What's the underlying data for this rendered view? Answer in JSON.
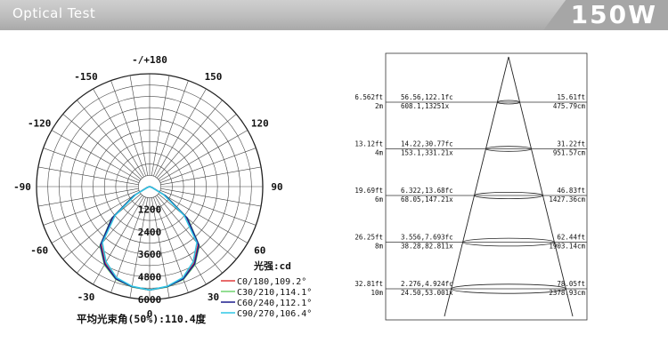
{
  "header": {
    "title": "Optical Test",
    "power": "150W"
  },
  "chart_data": [
    {
      "type": "polar-intensity",
      "angle_labels": [
        "-/+180",
        "-150",
        "150",
        "-120",
        "120",
        "-90",
        "90",
        "-60",
        "60",
        "-30",
        "30",
        "0"
      ],
      "radial_ticks": [
        1200,
        2400,
        3600,
        4800,
        6000
      ],
      "unit_label": "光强:cd",
      "series": [
        {
          "name": "C0/180,109.2°",
          "color": "#e03a3a",
          "values": [
            5500,
            5400,
            5200,
            4700,
            4000,
            2500,
            900,
            120,
            0
          ]
        },
        {
          "name": "C30/210,114.1°",
          "color": "#6fd36f",
          "values": [
            5500,
            5420,
            5250,
            4800,
            4100,
            2650,
            1000,
            150,
            0
          ]
        },
        {
          "name": "C60/240,112.1°",
          "color": "#1c1c8c",
          "values": [
            5500,
            5400,
            5220,
            4760,
            4060,
            2600,
            960,
            140,
            0
          ]
        },
        {
          "name": "C90/270,106.4°",
          "color": "#2ec7e6",
          "values": [
            5500,
            5380,
            5150,
            4620,
            3900,
            2400,
            850,
            110,
            0
          ]
        }
      ],
      "series_angles": [
        0,
        10,
        20,
        30,
        40,
        50,
        60,
        70,
        80
      ],
      "average_beam_angle": "平均光束角(50%):110.4度"
    },
    {
      "type": "illuminance-cone",
      "rows": [
        {
          "h_ft": "6.562ft",
          "h_m": "2m",
          "fc": "56.56,122.1fc",
          "lx": "608.1,13251x",
          "d_ft": "15.61ft",
          "d_cm": "475.79cm"
        },
        {
          "h_ft": "13.12ft",
          "h_m": "4m",
          "fc": "14.22,30.77fc",
          "lx": "153.1,331.21x",
          "d_ft": "31.22ft",
          "d_cm": "951.57cm"
        },
        {
          "h_ft": "19.69ft",
          "h_m": "6m",
          "fc": "6.322,13.68fc",
          "lx": "68.05,147.21x",
          "d_ft": "46.83ft",
          "d_cm": "1427.36cm"
        },
        {
          "h_ft": "26.25ft",
          "h_m": "8m",
          "fc": "3.556,7.693fc",
          "lx": "38.28,82.811x",
          "d_ft": "62.44ft",
          "d_cm": "1903.14cm"
        },
        {
          "h_ft": "32.81ft",
          "h_m": "10m",
          "fc": "2.276,4.924fc",
          "lx": "24.50,53.001x",
          "d_ft": "78.05ft",
          "d_cm": "2378.93cm"
        }
      ]
    }
  ]
}
